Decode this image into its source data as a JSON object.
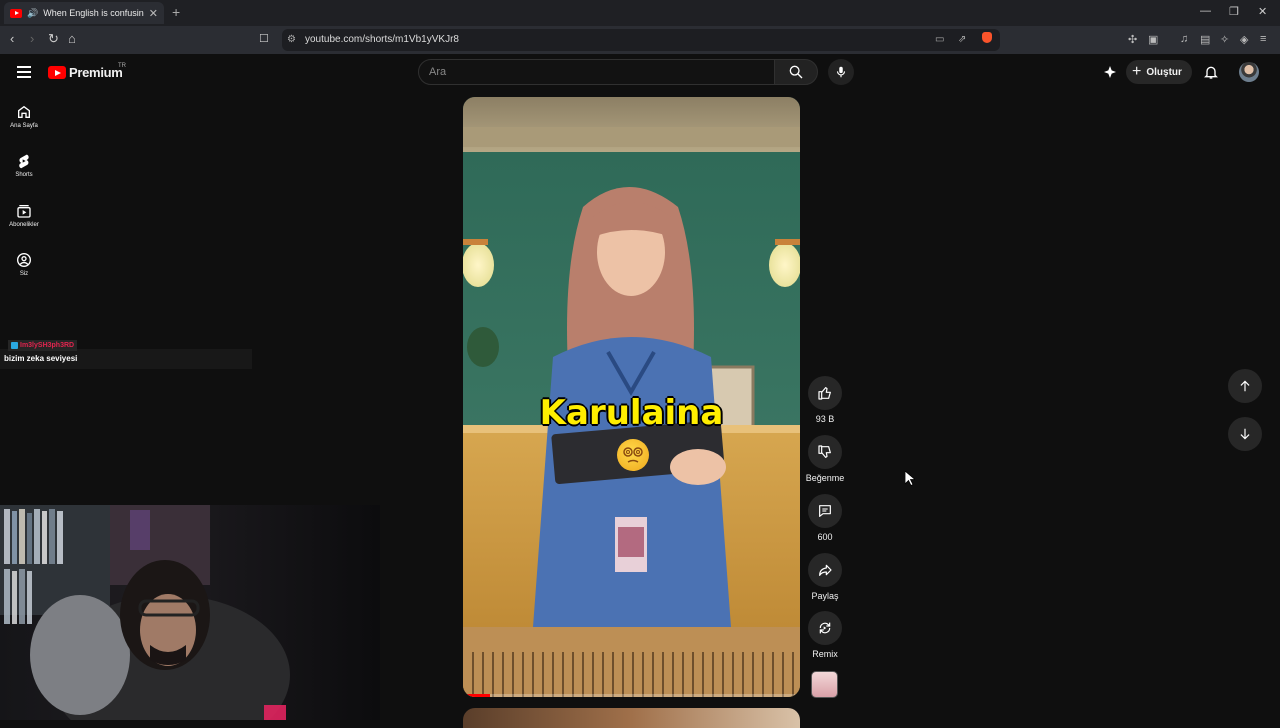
{
  "browser": {
    "tab_title": "When English is confusing",
    "new_tab_label": "+",
    "url": "youtube.com/shorts/m1Vb1yVKJr8"
  },
  "header": {
    "logo_text": "Premium",
    "logo_region": "TR",
    "search_placeholder": "Ara",
    "create_label": "Oluştur"
  },
  "sidebar": {
    "items": [
      {
        "label": "Ana Sayfa",
        "icon": "home-icon"
      },
      {
        "label": "Shorts",
        "icon": "shorts-icon"
      },
      {
        "label": "Abonelikler",
        "icon": "subscriptions-icon"
      },
      {
        "label": "Siz",
        "icon": "you-icon"
      }
    ]
  },
  "chat": {
    "username": "Im3lySH3ph3RD",
    "message": "bizim zeka seviyesi"
  },
  "video": {
    "caption": "Karulaina",
    "progress_fraction": 0.08,
    "accent": "#ff0000"
  },
  "actions": {
    "like_count": "93 B",
    "dislike_label": "Beğenme",
    "comment_count": "600",
    "share_label": "Paylaş",
    "remix_label": "Remix"
  }
}
